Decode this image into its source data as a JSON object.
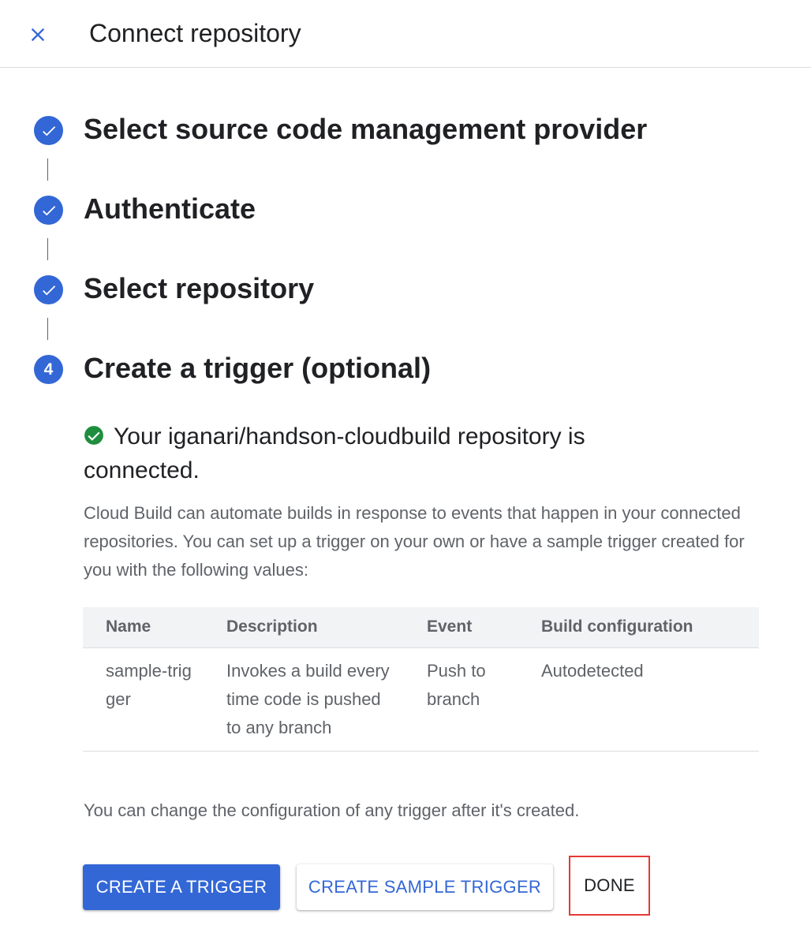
{
  "header": {
    "title": "Connect repository",
    "close_icon": "close-icon"
  },
  "colors": {
    "accent": "#3367d6",
    "success": "#1e8e3e",
    "highlight": "#e53935"
  },
  "steps": [
    {
      "label": "Select source code management provider",
      "state": "complete"
    },
    {
      "label": "Authenticate",
      "state": "complete"
    },
    {
      "label": "Select repository",
      "state": "complete"
    },
    {
      "label": "Create a trigger (optional)",
      "state": "active",
      "number": "4"
    }
  ],
  "success_message": "Your iganari/handson-cloudbuild repository is connected.",
  "description": "Cloud Build can automate builds in response to events that happen in your connected repositories. You can set up a trigger on your own or have a sample trigger created for you with the following values:",
  "table": {
    "headers": [
      "Name",
      "Description",
      "Event",
      "Build configuration"
    ],
    "rows": [
      [
        "sample-trigger",
        "Invokes a build every time code is pushed to any branch",
        "Push to branch",
        "Autodetected"
      ]
    ]
  },
  "footnote": "You can change the configuration of any trigger after it's created.",
  "buttons": {
    "create_trigger": "CREATE A TRIGGER",
    "create_sample": "CREATE SAMPLE TRIGGER",
    "done": "DONE"
  }
}
